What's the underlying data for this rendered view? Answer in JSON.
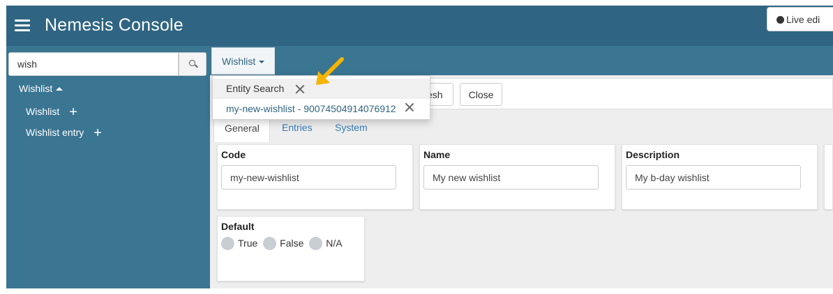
{
  "header": {
    "title": "Nemesis Console",
    "live_button_label": "Live edi"
  },
  "sidebar": {
    "search": {
      "value": "wish",
      "icon": "search-icon"
    },
    "group_label": "Wishlist",
    "items": [
      {
        "label": "Wishlist"
      },
      {
        "label": "Wishlist entry"
      }
    ]
  },
  "topbar": {
    "menu_label": "Wishlist"
  },
  "dropdown": {
    "items": [
      {
        "label": "Entity Search"
      },
      {
        "label": "my-new-wishlist - 90074504914076912"
      }
    ]
  },
  "toolbar": {
    "refresh_label": "esh",
    "close_label": "Close"
  },
  "tabs": [
    {
      "label": "General"
    },
    {
      "label": "Entries"
    },
    {
      "label": "System"
    }
  ],
  "form": {
    "code": {
      "label": "Code",
      "value": "my-new-wishlist"
    },
    "name": {
      "label": "Name",
      "value": "My new wishlist"
    },
    "description": {
      "label": "Description",
      "value": "My b-day wishlist"
    },
    "default": {
      "label": "Default",
      "options": [
        "True",
        "False",
        "N/A"
      ]
    }
  },
  "colors": {
    "header": "#2f6583",
    "sidebar": "#3a7592",
    "arrow": "#f5b400"
  }
}
